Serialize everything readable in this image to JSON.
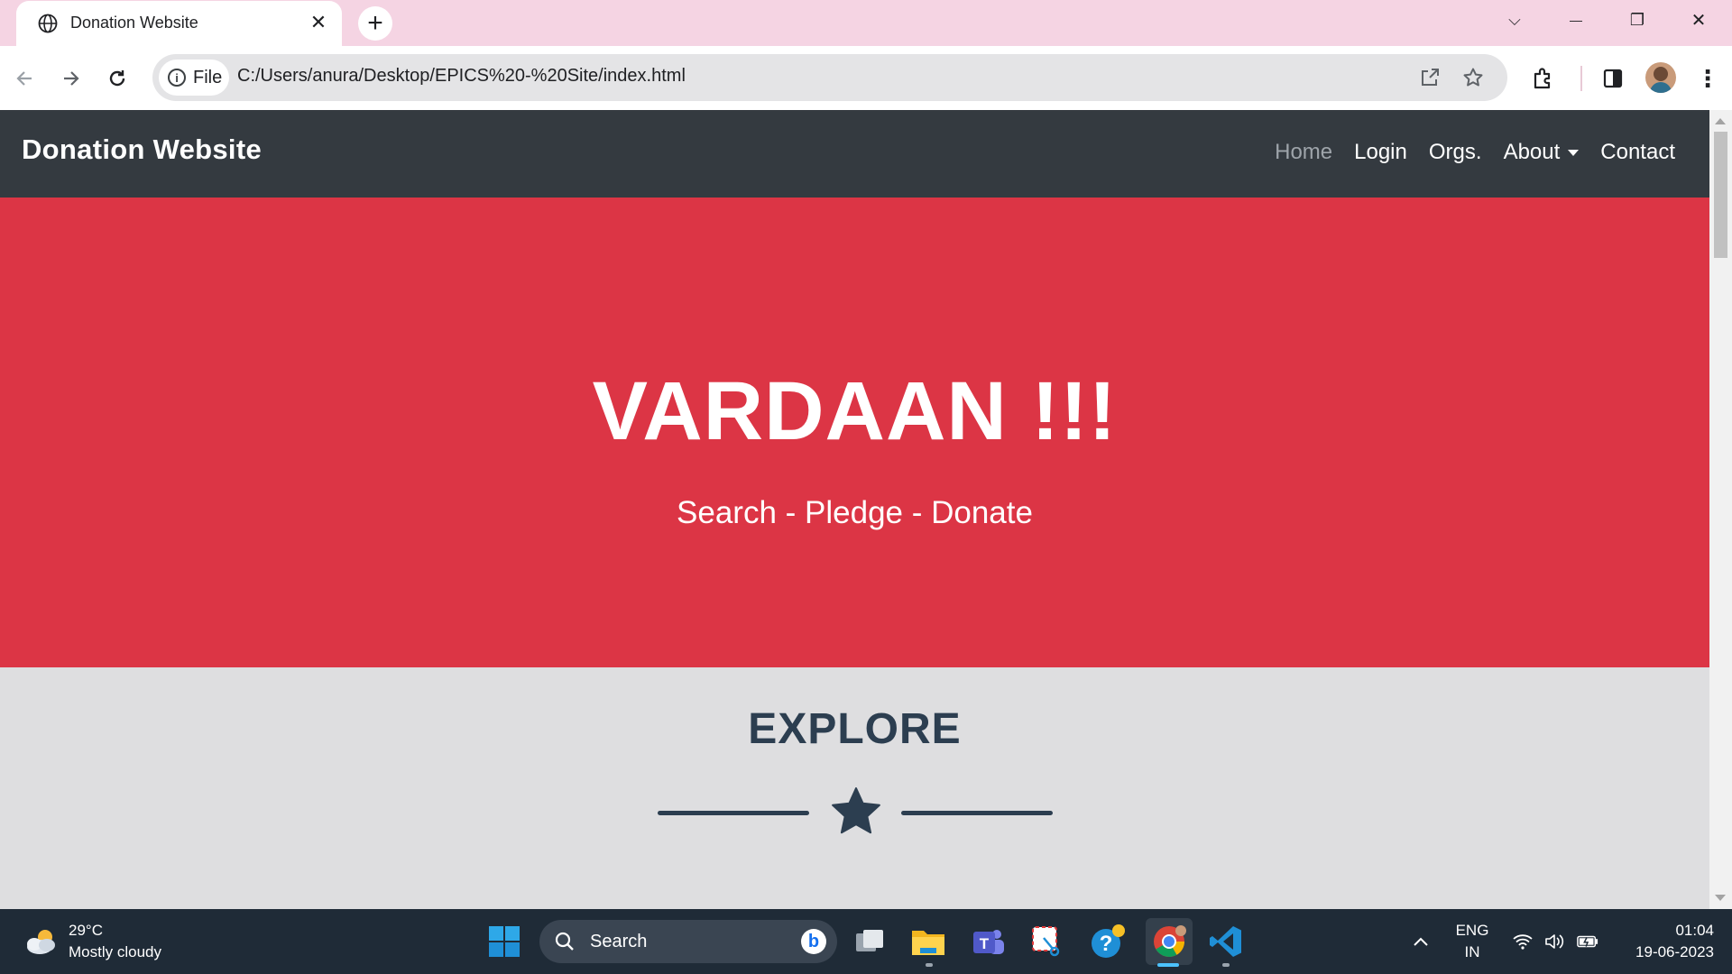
{
  "browser": {
    "tab_title": "Donation Website",
    "tab_close": "✕",
    "new_tab": "+",
    "window_controls": {
      "dropdown": "⌵",
      "minimize": "—",
      "restore": "❐",
      "close": "✕"
    },
    "site_info_label": "File",
    "url": "C:/Users/anura/Desktop/EPICS%20-%20Site/index.html"
  },
  "site": {
    "brand": "Donation Website",
    "nav": {
      "home": "Home",
      "login": "Login",
      "orgs": "Orgs.",
      "about": "About",
      "contact": "Contact"
    },
    "hero": {
      "title": "VARDAAN !!!",
      "subtitle": "Search - Pledge - Donate"
    },
    "explore": {
      "title": "EXPLORE"
    }
  },
  "colors": {
    "navbar": "#343a40",
    "hero": "#dc3545",
    "explore_bg": "#dedee0",
    "heading": "#2c3e50",
    "tab_strip": "#f5d4e3",
    "taskbar": "#1f2b37"
  },
  "taskbar": {
    "weather": {
      "temp": "29°C",
      "desc": "Mostly cloudy"
    },
    "search_label": "Search",
    "language": {
      "line1": "ENG",
      "line2": "IN"
    },
    "clock": {
      "time": "01:04",
      "date": "19-06-2023"
    },
    "apps": [
      "windows-start-icon",
      "task-view-icon",
      "file-explorer-icon",
      "teams-icon",
      "snipping-tool-icon",
      "help-icon",
      "chrome-icon",
      "vscode-icon"
    ]
  }
}
